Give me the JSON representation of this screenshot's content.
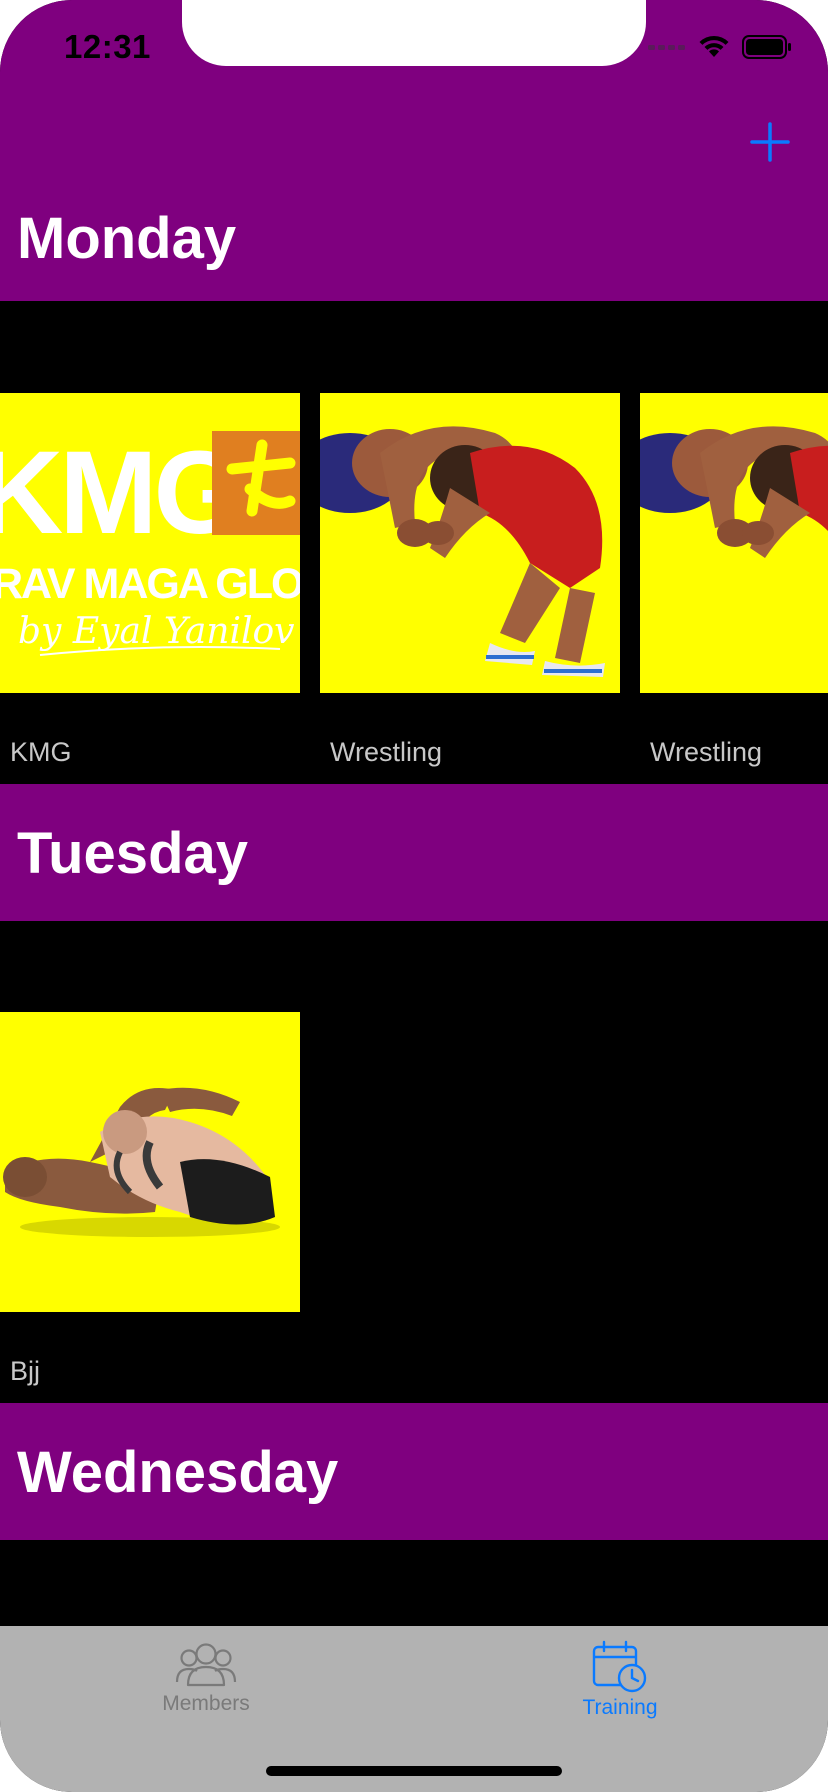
{
  "status_bar": {
    "time": "12:31"
  },
  "navigation": {
    "add_icon": "plus-icon",
    "accent_color": "#0a7aff"
  },
  "colors": {
    "header_purple": "#7f007f",
    "card_background": "#ffff00",
    "content_background": "#000000",
    "tab_bar_background": "#b2b2b2",
    "tab_active": "#0a7aff",
    "tab_inactive": "#7a7a7a"
  },
  "days": [
    {
      "name": "Monday",
      "classes": [
        {
          "label": "KMG",
          "image": "kmg-logo-image"
        },
        {
          "label": "Wrestling",
          "image": "wrestling-image"
        },
        {
          "label": "Wrestling",
          "image": "wrestling-image"
        }
      ]
    },
    {
      "name": "Tuesday",
      "classes": [
        {
          "label": "Bjj",
          "image": "bjj-image"
        }
      ]
    },
    {
      "name": "Wednesday",
      "classes": []
    }
  ],
  "kmg_logo": {
    "line1": "KMG",
    "line2": "RAV MAGA GLOBA",
    "line3": "by Eyal Yanilov"
  },
  "tab_bar": {
    "tabs": [
      {
        "label": "Members",
        "icon": "members-icon",
        "active": false
      },
      {
        "label": "Training",
        "icon": "calendar-clock-icon",
        "active": true
      }
    ]
  }
}
